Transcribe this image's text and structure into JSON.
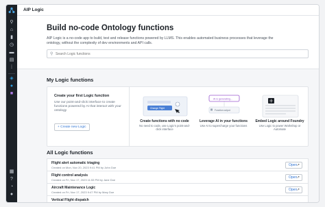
{
  "app": {
    "title": "AIP Logic"
  },
  "rail": {
    "icons": [
      "aip-logo-icon",
      "search-icon",
      "home-icon",
      "bookmark-icon",
      "history-icon",
      "folder-icon",
      "catalog-icon",
      "apps-icon",
      "logic-app-icon",
      "ontology-icon",
      "assist-icon",
      "help-icon",
      "notifications-icon",
      "user-icon"
    ]
  },
  "hero": {
    "title": "Build no-code Ontology functions",
    "description": "AIP Logic is a no-code app to build, test and release functions powered by LLMS. This enables automated business processes that leverage the ontology, without the complexity of dev environments and API calls.",
    "search_placeholder": "Search Logic functions"
  },
  "my_functions": {
    "heading": "My Logic functions",
    "create_title": "Create your first Logic function",
    "create_description": "Use our point-and-click interface to create functions powered by AI that interact with your ontology",
    "create_button": "+  Create new Logic",
    "features": [
      {
        "title": "Create functions with no code",
        "description": "No need to code, use Logic's point-and-click interface",
        "art_label": "Change Flight"
      },
      {
        "title": "Leverage AI in your functions",
        "description": "Use AI to supercharge your functions",
        "art_label": "AI is generating...",
        "art_sublabel": "Function output"
      },
      {
        "title": "Embed Logic around Foundry",
        "description": "Use Logic to power Workshop or Automate",
        "art_label": ""
      }
    ]
  },
  "all_functions": {
    "heading": "All Logic functions",
    "open_label": "Open",
    "rows": [
      {
        "title": "Flight alert automatic triaging",
        "subtitle": "Created on Mon, Nov 20, 2023 9:41 PM by John Doe"
      },
      {
        "title": "Flight control analysis",
        "subtitle": "Created on Fri, Nov 17, 2023 11:53 PM by Jane Doe"
      },
      {
        "title": "Aircraft Maintenance Logic",
        "subtitle": "Created on Fri, Nov 17, 2023 9:47 PM by Mary Doe"
      },
      {
        "title": "Vertical Flight dispatch",
        "subtitle": ""
      }
    ]
  },
  "colors": {
    "accent": "#2d72d2",
    "rail_bg": "#1c2127",
    "active_icon": "#2d9cdb",
    "ai_purple": "#9b59d0"
  }
}
